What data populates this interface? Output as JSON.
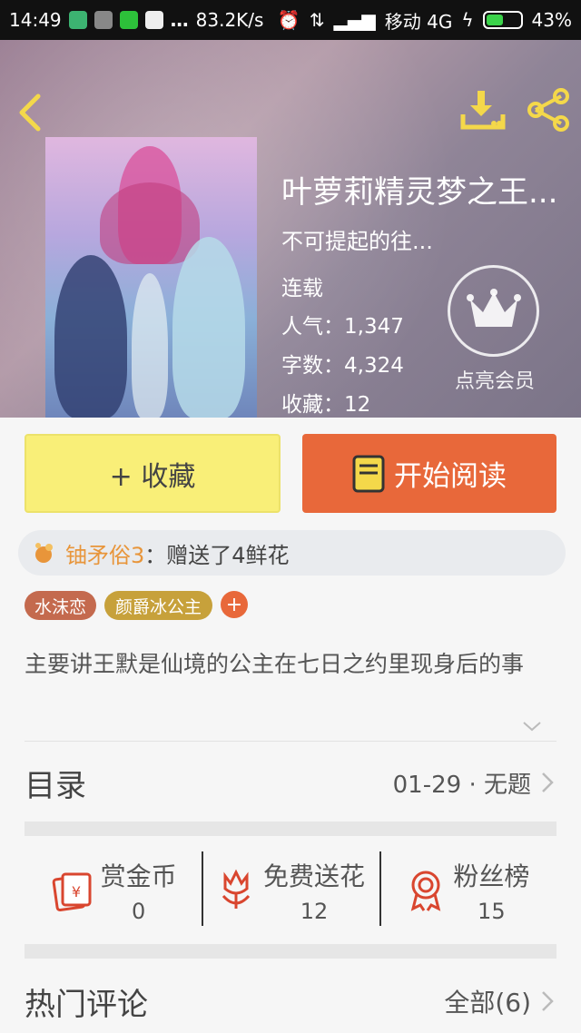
{
  "status_bar": {
    "time": "14:49",
    "speed": "83.2K/s",
    "carrier": "移动 4G",
    "battery": "43%"
  },
  "book": {
    "title": "叶萝莉精灵梦之王...",
    "subtitle": "不可提起的往...",
    "status": "连载",
    "popularity_label": "人气：",
    "popularity": "1,347",
    "words_label": "字数：",
    "words": "4,324",
    "favorites_label": "收藏：",
    "favorites": "12"
  },
  "vip": {
    "label": "点亮会员"
  },
  "actions": {
    "favorite": "+ 收藏",
    "read": "开始阅读"
  },
  "gift_notice": {
    "user": "铀矛俗3",
    "text": "：赠送了4鲜花"
  },
  "tags": [
    {
      "label": "水沫恋",
      "color": "#c46a4e"
    },
    {
      "label": "颜爵冰公主",
      "color": "#c7a13b"
    }
  ],
  "tag_add": "+",
  "description": "主要讲王默是仙境的公主在七日之约里现身后的事",
  "toc": {
    "label": "目录",
    "latest": "01-29 · 无题"
  },
  "stats": [
    {
      "name": "赏金币",
      "value": "0",
      "icon": "red-envelope-icon"
    },
    {
      "name": "免费送花",
      "value": "12",
      "icon": "flower-icon"
    },
    {
      "name": "粉丝榜",
      "value": "15",
      "icon": "medal-icon"
    }
  ],
  "comments": {
    "label": "热门评论",
    "all": "全部(6)"
  },
  "colors": {
    "accent": "#e8683a",
    "favorite_button": "#f9ef78",
    "gift_user": "#e8953a"
  }
}
